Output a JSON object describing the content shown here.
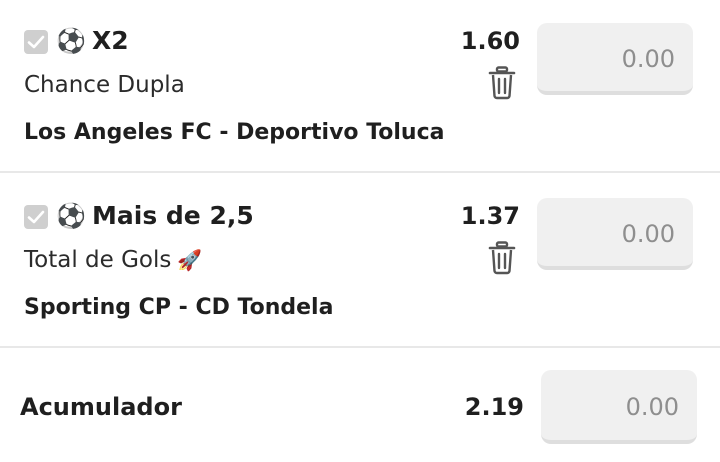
{
  "bets": [
    {
      "selection": "X2",
      "market": "Chance Dupla",
      "home": "Los Angeles FC",
      "separator": "-",
      "away": "Deportivo Toluca",
      "odds": "1.60",
      "stake": "0.00",
      "checked": true
    },
    {
      "selection": "Mais de 2,5",
      "market": "Total de Gols",
      "home": "Sporting CP",
      "separator": "-",
      "away": "CD Tondela",
      "odds": "1.37",
      "stake": "0.00",
      "checked": true
    }
  ],
  "accumulator": {
    "label": "Acumulador",
    "odds": "2.19",
    "stake": "0.00"
  },
  "icons": {
    "sport": "soccer-ball-icon",
    "delete": "trash-icon",
    "hot_market": "rocket-icon"
  },
  "colors": {
    "checkbox": "#cfcfcf",
    "input_bg": "#f0f0f0",
    "divider": "#e8e8e8"
  }
}
